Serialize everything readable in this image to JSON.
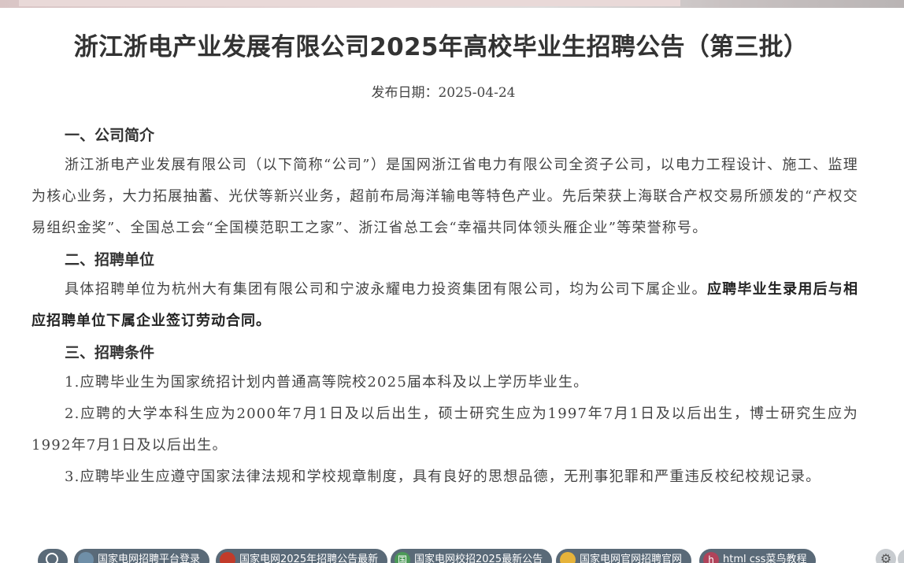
{
  "title": "浙江浙电产业发展有限公司2025年高校毕业生招聘公告（第三批）",
  "publish_date": "发布日期：2025-04-24",
  "sections": [
    {
      "heading": "一、公司简介",
      "paragraphs": [
        "浙江浙电产业发展有限公司（以下简称“公司”）是国网浙江省电力有限公司全资子公司，以电力工程设计、施工、监理为核心业务，大力拓展抽蓄、光伏等新兴业务，超前布局海洋输电等特色产业。先后荣获上海联合产权交易所颁发的“产权交易组织金奖”、全国总工会“全国模范职工之家”、浙江省总工会“幸福共同体领头雁企业”等荣誉称号。"
      ]
    },
    {
      "heading": "二、招聘单位",
      "paragraph_plain": "具体招聘单位为杭州大有集团有限公司和宁波永耀电力投资集团有限公司，均为公司下属企业。",
      "paragraph_bold": "应聘毕业生录用后与相应招聘单位下属企业签订劳动合同。"
    },
    {
      "heading": "三、招聘条件",
      "paragraphs": [
        "1.应聘毕业生为国家统招计划内普通高等院校2025届本科及以上学历毕业生。",
        "2.应聘的大学本科生应为2000年7月1日及以后出生，硕士研究生应为1997年7月1日及以后出生，博士研究生应为1992年7月1日及以后出生。",
        "3.应聘毕业生应遵守国家法律法规和学校规章制度，具有良好的思想品德，无刑事犯罪和严重违反校纪校规记录。"
      ]
    }
  ],
  "bookmarks": [
    {
      "label": "国家电网招聘平台登录",
      "icon": "globe-icon",
      "color": "#6f8fa8"
    },
    {
      "label": "国家电网2025年招聘公告最新",
      "icon": "flag-icon",
      "color": "#c23b2a"
    },
    {
      "label": "国家电网校招2025最新公告",
      "icon": "site-icon",
      "color": "#4c9a58"
    },
    {
      "label": "国家电网官网招聘官网",
      "icon": "emoji-icon",
      "color": "#e6b33a"
    },
    {
      "label": "html css菜鸟教程",
      "icon": "h-icon",
      "color": "#b0435a"
    }
  ],
  "bookmark_icon_letters": {
    "site": "国",
    "h": "h"
  }
}
